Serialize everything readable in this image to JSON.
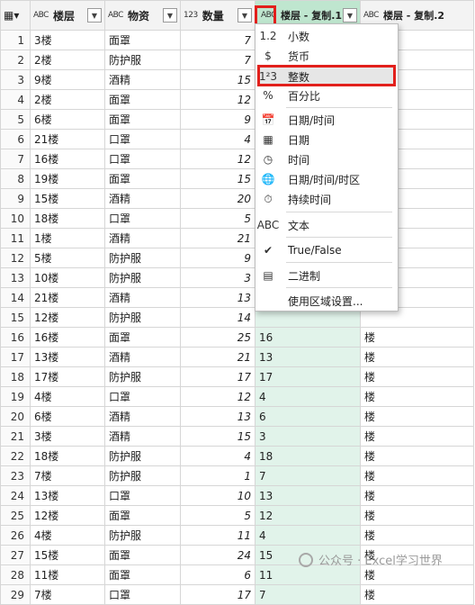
{
  "header": {
    "corner_icon": "table-icon",
    "columns": [
      {
        "type_icon": "ABC",
        "name": "楼层"
      },
      {
        "type_icon": "ABC",
        "name": "物资"
      },
      {
        "type_icon": "123",
        "name": "数量"
      },
      {
        "type_icon": "ABC",
        "name": "楼层 - 复制.1"
      },
      {
        "type_icon": "ABC",
        "name": "楼层 - 复制.2"
      }
    ]
  },
  "rows": [
    {
      "n": "1",
      "floor": "3楼",
      "item": "面罩",
      "qty": "7",
      "c1": "",
      "c2": ""
    },
    {
      "n": "2",
      "floor": "2楼",
      "item": "防护服",
      "qty": "7",
      "c1": "",
      "c2": ""
    },
    {
      "n": "3",
      "floor": "9楼",
      "item": "酒精",
      "qty": "15",
      "c1": "",
      "c2": ""
    },
    {
      "n": "4",
      "floor": "2楼",
      "item": "面罩",
      "qty": "12",
      "c1": "",
      "c2": ""
    },
    {
      "n": "5",
      "floor": "6楼",
      "item": "面罩",
      "qty": "9",
      "c1": "",
      "c2": ""
    },
    {
      "n": "6",
      "floor": "21楼",
      "item": "口罩",
      "qty": "4",
      "c1": "",
      "c2": ""
    },
    {
      "n": "7",
      "floor": "16楼",
      "item": "口罩",
      "qty": "12",
      "c1": "",
      "c2": ""
    },
    {
      "n": "8",
      "floor": "19楼",
      "item": "面罩",
      "qty": "15",
      "c1": "",
      "c2": ""
    },
    {
      "n": "9",
      "floor": "15楼",
      "item": "酒精",
      "qty": "20",
      "c1": "",
      "c2": ""
    },
    {
      "n": "10",
      "floor": "18楼",
      "item": "口罩",
      "qty": "5",
      "c1": "",
      "c2": ""
    },
    {
      "n": "11",
      "floor": "1楼",
      "item": "酒精",
      "qty": "21",
      "c1": "",
      "c2": ""
    },
    {
      "n": "12",
      "floor": "5楼",
      "item": "防护服",
      "qty": "9",
      "c1": "",
      "c2": ""
    },
    {
      "n": "13",
      "floor": "10楼",
      "item": "防护服",
      "qty": "3",
      "c1": "",
      "c2": ""
    },
    {
      "n": "14",
      "floor": "21楼",
      "item": "酒精",
      "qty": "13",
      "c1": "",
      "c2": ""
    },
    {
      "n": "15",
      "floor": "12楼",
      "item": "防护服",
      "qty": "14",
      "c1": "",
      "c2": ""
    },
    {
      "n": "16",
      "floor": "16楼",
      "item": "面罩",
      "qty": "25",
      "c1": "16",
      "c2": "楼"
    },
    {
      "n": "17",
      "floor": "13楼",
      "item": "酒精",
      "qty": "21",
      "c1": "13",
      "c2": "楼"
    },
    {
      "n": "18",
      "floor": "17楼",
      "item": "防护服",
      "qty": "17",
      "c1": "17",
      "c2": "楼"
    },
    {
      "n": "19",
      "floor": "4楼",
      "item": "口罩",
      "qty": "12",
      "c1": "4",
      "c2": "楼"
    },
    {
      "n": "20",
      "floor": "6楼",
      "item": "酒精",
      "qty": "13",
      "c1": "6",
      "c2": "楼"
    },
    {
      "n": "21",
      "floor": "3楼",
      "item": "酒精",
      "qty": "15",
      "c1": "3",
      "c2": "楼"
    },
    {
      "n": "22",
      "floor": "18楼",
      "item": "防护服",
      "qty": "4",
      "c1": "18",
      "c2": "楼"
    },
    {
      "n": "23",
      "floor": "7楼",
      "item": "防护服",
      "qty": "1",
      "c1": "7",
      "c2": "楼"
    },
    {
      "n": "24",
      "floor": "13楼",
      "item": "口罩",
      "qty": "10",
      "c1": "13",
      "c2": "楼"
    },
    {
      "n": "25",
      "floor": "12楼",
      "item": "面罩",
      "qty": "5",
      "c1": "12",
      "c2": "楼"
    },
    {
      "n": "26",
      "floor": "4楼",
      "item": "防护服",
      "qty": "11",
      "c1": "4",
      "c2": "楼"
    },
    {
      "n": "27",
      "floor": "15楼",
      "item": "面罩",
      "qty": "24",
      "c1": "15",
      "c2": "楼"
    },
    {
      "n": "28",
      "floor": "11楼",
      "item": "面罩",
      "qty": "6",
      "c1": "11",
      "c2": "楼"
    },
    {
      "n": "29",
      "floor": "7楼",
      "item": "口罩",
      "qty": "17",
      "c1": "7",
      "c2": "楼"
    }
  ],
  "menu": {
    "items": [
      {
        "icon": "1.2",
        "label": "小数",
        "name": "decimal"
      },
      {
        "icon": "$",
        "label": "货币",
        "name": "currency"
      },
      {
        "icon": "1²3",
        "label": "整数",
        "name": "whole-number"
      },
      {
        "icon": "%",
        "label": "百分比",
        "name": "percentage"
      },
      {
        "icon": "📅",
        "label": "日期/时间",
        "name": "datetime"
      },
      {
        "icon": "▦",
        "label": "日期",
        "name": "date"
      },
      {
        "icon": "◷",
        "label": "时间",
        "name": "time"
      },
      {
        "icon": "🌐",
        "label": "日期/时间/时区",
        "name": "datetime-timezone"
      },
      {
        "icon": "⏱",
        "label": "持续时间",
        "name": "duration"
      },
      {
        "icon": "ABC",
        "label": "文本",
        "name": "text"
      },
      {
        "icon": "✔",
        "label": "True/False",
        "name": "true-false"
      },
      {
        "icon": "▤",
        "label": "二进制",
        "name": "binary"
      },
      {
        "icon": "",
        "label": "使用区域设置...",
        "name": "using-locale"
      }
    ]
  },
  "watermark": {
    "text": "公众号 · Excel学习世界"
  },
  "colors": {
    "selected_column": "#e1f3ea",
    "highlight_border": "#e2201c"
  }
}
